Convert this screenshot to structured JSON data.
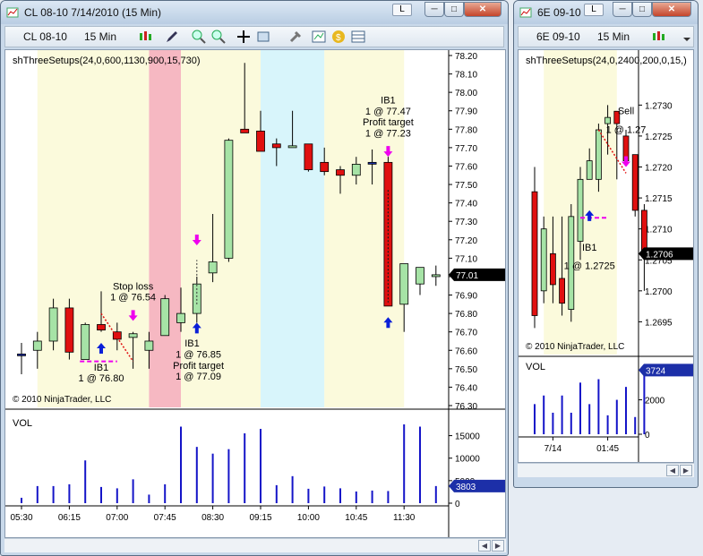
{
  "left_window": {
    "title": "CL 08-10  7/14/2010 (15 Min)",
    "instrument": "CL 08-10",
    "interval": "15 Min",
    "caption_btn": "L",
    "indicator": "shThreeSetups(24,0,600,1130,900,15,730)",
    "copyright": "© 2010 NinjaTrader, LLC",
    "price_axis": [
      "78.20",
      "78.10",
      "78.00",
      "77.90",
      "77.80",
      "77.70",
      "77.60",
      "77.50",
      "77.40",
      "77.30",
      "77.20",
      "77.10",
      "77.00",
      "76.90",
      "76.80",
      "76.70",
      "76.60",
      "76.50",
      "76.40",
      "76.30"
    ],
    "last_price": "77.01",
    "vol_label": "VOL",
    "vol_axis": [
      "15000",
      "10000",
      "5000",
      "0"
    ],
    "vol_last": "3803",
    "time_axis": [
      "05:30",
      "06:15",
      "07:00",
      "07:45",
      "08:30",
      "09:15",
      "10:00",
      "10:45",
      "11:30"
    ],
    "annotations": {
      "stop1": "Stop loss",
      "stop2": "1 @ 76.54",
      "ib_a1": "IB1",
      "ib_a2": "1 @ 76.80",
      "ib_b1": "IB1",
      "ib_b2": "1 @ 76.85",
      "ib_b3": "Profit target",
      "ib_b4": "1 @ 77.09",
      "ib_c1": "IB1",
      "ib_c2": "1 @ 77.47",
      "ib_c3": "Profit target",
      "ib_c4": "1 @ 77.23"
    }
  },
  "right_window": {
    "title": "6E 09-10",
    "instrument": "6E 09-10",
    "interval": "15 Min",
    "caption_btn": "L",
    "indicator": "shThreeSetups(24,0,2400,200,0,15,)",
    "copyright": "© 2010 NinjaTrader, LLC",
    "price_axis": [
      "1.2730",
      "1.2725",
      "1.2720",
      "1.2715",
      "1.2710",
      "1.2705",
      "1.2700",
      "1.2695"
    ],
    "last_price": "1.2706",
    "vol_label": "VOL",
    "vol_axis": [
      "2000",
      "0"
    ],
    "vol_last": "3724",
    "time_axis": [
      "7/14",
      "01:45"
    ],
    "annotations": {
      "sell1": "Sell",
      "sell2": "1 @ 1.27",
      "ib1": "IB1",
      "ib2": "1 @ 1.2725"
    }
  },
  "colors": {
    "up": "#a6e3a6",
    "down": "#e01010",
    "doji": "#1c2fa8",
    "volume": "#1414c8",
    "zone_yellow": "#fbfadc",
    "zone_pink": "#f6b8c2",
    "zone_cyan": "#d8f5fb",
    "magenta": "#ee00ee"
  },
  "icons": [
    "bar-chart-icon",
    "pencil-icon",
    "zoom-in-icon",
    "zoom-out-icon",
    "crosshair-icon",
    "properties-icon",
    "hammer-icon",
    "chart-icon",
    "dollar-icon",
    "table-icon"
  ],
  "chart_data": [
    {
      "type": "candlestick",
      "name": "CL 08-10",
      "timeframe": "15 Min",
      "ylim": [
        76.3,
        78.2
      ],
      "ohlc": [
        [
          76.58,
          76.64,
          76.47,
          76.58
        ],
        [
          76.6,
          76.7,
          76.5,
          76.65
        ],
        [
          76.65,
          76.88,
          76.6,
          76.83
        ],
        [
          76.83,
          76.88,
          76.55,
          76.59
        ],
        [
          76.55,
          76.75,
          76.55,
          76.74
        ],
        [
          76.74,
          76.92,
          76.7,
          76.71
        ],
        [
          76.7,
          76.75,
          76.6,
          76.66
        ],
        [
          76.67,
          76.7,
          76.5,
          76.69
        ],
        [
          76.6,
          76.7,
          76.5,
          76.65
        ],
        [
          76.68,
          76.9,
          76.68,
          76.88
        ],
        [
          76.75,
          76.94,
          76.7,
          76.8
        ],
        [
          76.8,
          77.0,
          76.75,
          76.96
        ],
        [
          77.02,
          77.34,
          76.97,
          77.08
        ],
        [
          77.1,
          77.75,
          77.08,
          77.74
        ],
        [
          77.8,
          78.16,
          77.78,
          77.78
        ],
        [
          77.79,
          77.9,
          77.7,
          77.68
        ],
        [
          77.72,
          77.75,
          77.6,
          77.7
        ],
        [
          77.7,
          77.9,
          77.7,
          77.71
        ],
        [
          77.72,
          77.72,
          77.57,
          77.58
        ],
        [
          77.62,
          77.7,
          77.55,
          77.57
        ],
        [
          77.58,
          77.6,
          77.45,
          77.55
        ],
        [
          77.55,
          77.65,
          77.5,
          77.61
        ],
        [
          77.62,
          77.69,
          77.5,
          77.62
        ],
        [
          77.62,
          77.65,
          77.0,
          76.84
        ],
        [
          76.85,
          77.05,
          76.7,
          77.07
        ],
        [
          76.96,
          77.0,
          76.9,
          77.05
        ],
        [
          77.0,
          77.06,
          76.95,
          77.01
        ]
      ],
      "volume": [
        1200,
        3800,
        3800,
        4200,
        9500,
        3600,
        3300,
        5300,
        1900,
        4200,
        17000,
        12500,
        11000,
        12000,
        15500,
        16500,
        4000,
        6000,
        3200,
        3700,
        3300,
        2600,
        2800,
        2700,
        17500,
        17000,
        3803
      ],
      "annotations": [
        "Stop loss 1 @ 76.54",
        "IB1 1 @ 76.80",
        "IB1 1 @ 76.85 Profit target 1 @ 77.09",
        "IB1 1 @ 77.47 Profit target 1 @ 77.23"
      ]
    },
    {
      "type": "candlestick",
      "name": "6E 09-10",
      "timeframe": "15 Min",
      "ylim": [
        1.269,
        1.2738
      ],
      "ohlc": [
        [
          1.2716,
          1.272,
          1.2694,
          1.2696
        ],
        [
          1.27,
          1.2712,
          1.2698,
          1.271
        ],
        [
          1.2706,
          1.2712,
          1.2698,
          1.2701
        ],
        [
          1.2702,
          1.2712,
          1.2696,
          1.2698
        ],
        [
          1.2697,
          1.2714,
          1.2695,
          1.2712
        ],
        [
          1.2708,
          1.272,
          1.2705,
          1.2718
        ],
        [
          1.2718,
          1.2723,
          1.2718,
          1.2721
        ],
        [
          1.2718,
          1.2727,
          1.2716,
          1.2726
        ],
        [
          1.2727,
          1.273,
          1.2722,
          1.2728
        ],
        [
          1.2729,
          1.2729,
          1.2718,
          1.2727
        ],
        [
          1.2725,
          1.2726,
          1.2721,
          1.2721
        ],
        [
          1.2722,
          1.2722,
          1.2712,
          1.2713
        ],
        [
          1.2713,
          1.2714,
          1.27,
          1.2706
        ]
      ],
      "volume": [
        1750,
        2250,
        1250,
        2250,
        1250,
        3000,
        1750,
        3200,
        1100,
        2000,
        2750,
        1000,
        3724
      ],
      "annotations": [
        "Sell 1 @ 1.27",
        "IB1 1 @ 1.2725"
      ]
    }
  ]
}
